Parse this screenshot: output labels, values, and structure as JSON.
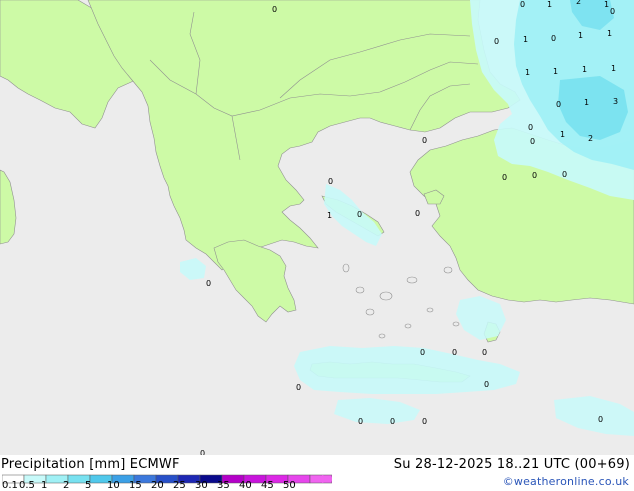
{
  "header": {
    "title": "Precipitation [mm] ECMWF",
    "datetime": "Su 28-12-2025 18..21 UTC (00+69)",
    "credit": "©weatheronline.co.uk"
  },
  "legend": {
    "labels": [
      "0.1",
      "0.5",
      "1",
      "2",
      "5",
      "10",
      "15",
      "20",
      "25",
      "30",
      "35",
      "40",
      "45",
      "50"
    ],
    "colors": [
      "#ffffff",
      "#c8fafa",
      "#a0f0f5",
      "#78e1f0",
      "#50c8eb",
      "#3ca0e6",
      "#3c78dc",
      "#2850c8",
      "#1e28b4",
      "#0a0a8c",
      "#b400c8",
      "#c814dc",
      "#dc28e6",
      "#e646ec",
      "#f064f0"
    ]
  },
  "colors": {
    "land": "#cdfaa6",
    "sea": "#ececec",
    "precip_light": "#c8fafa",
    "precip_mid": "#a0f0f5",
    "precip_strong": "#78e1f0",
    "border": "#a0a0a0"
  },
  "map_values": [
    "0",
    "1",
    "2",
    "1",
    "0",
    "0",
    "1",
    "0",
    "1",
    "1",
    "1",
    "1",
    "1",
    "1",
    "3",
    "1",
    "0",
    "0",
    "2",
    "1",
    "0",
    "0",
    "0",
    "0",
    "1",
    "0",
    "0",
    "0",
    "0",
    "0",
    "0",
    "0",
    "0",
    "0",
    "0",
    "0",
    "0",
    "0",
    "0",
    "0",
    "0"
  ]
}
